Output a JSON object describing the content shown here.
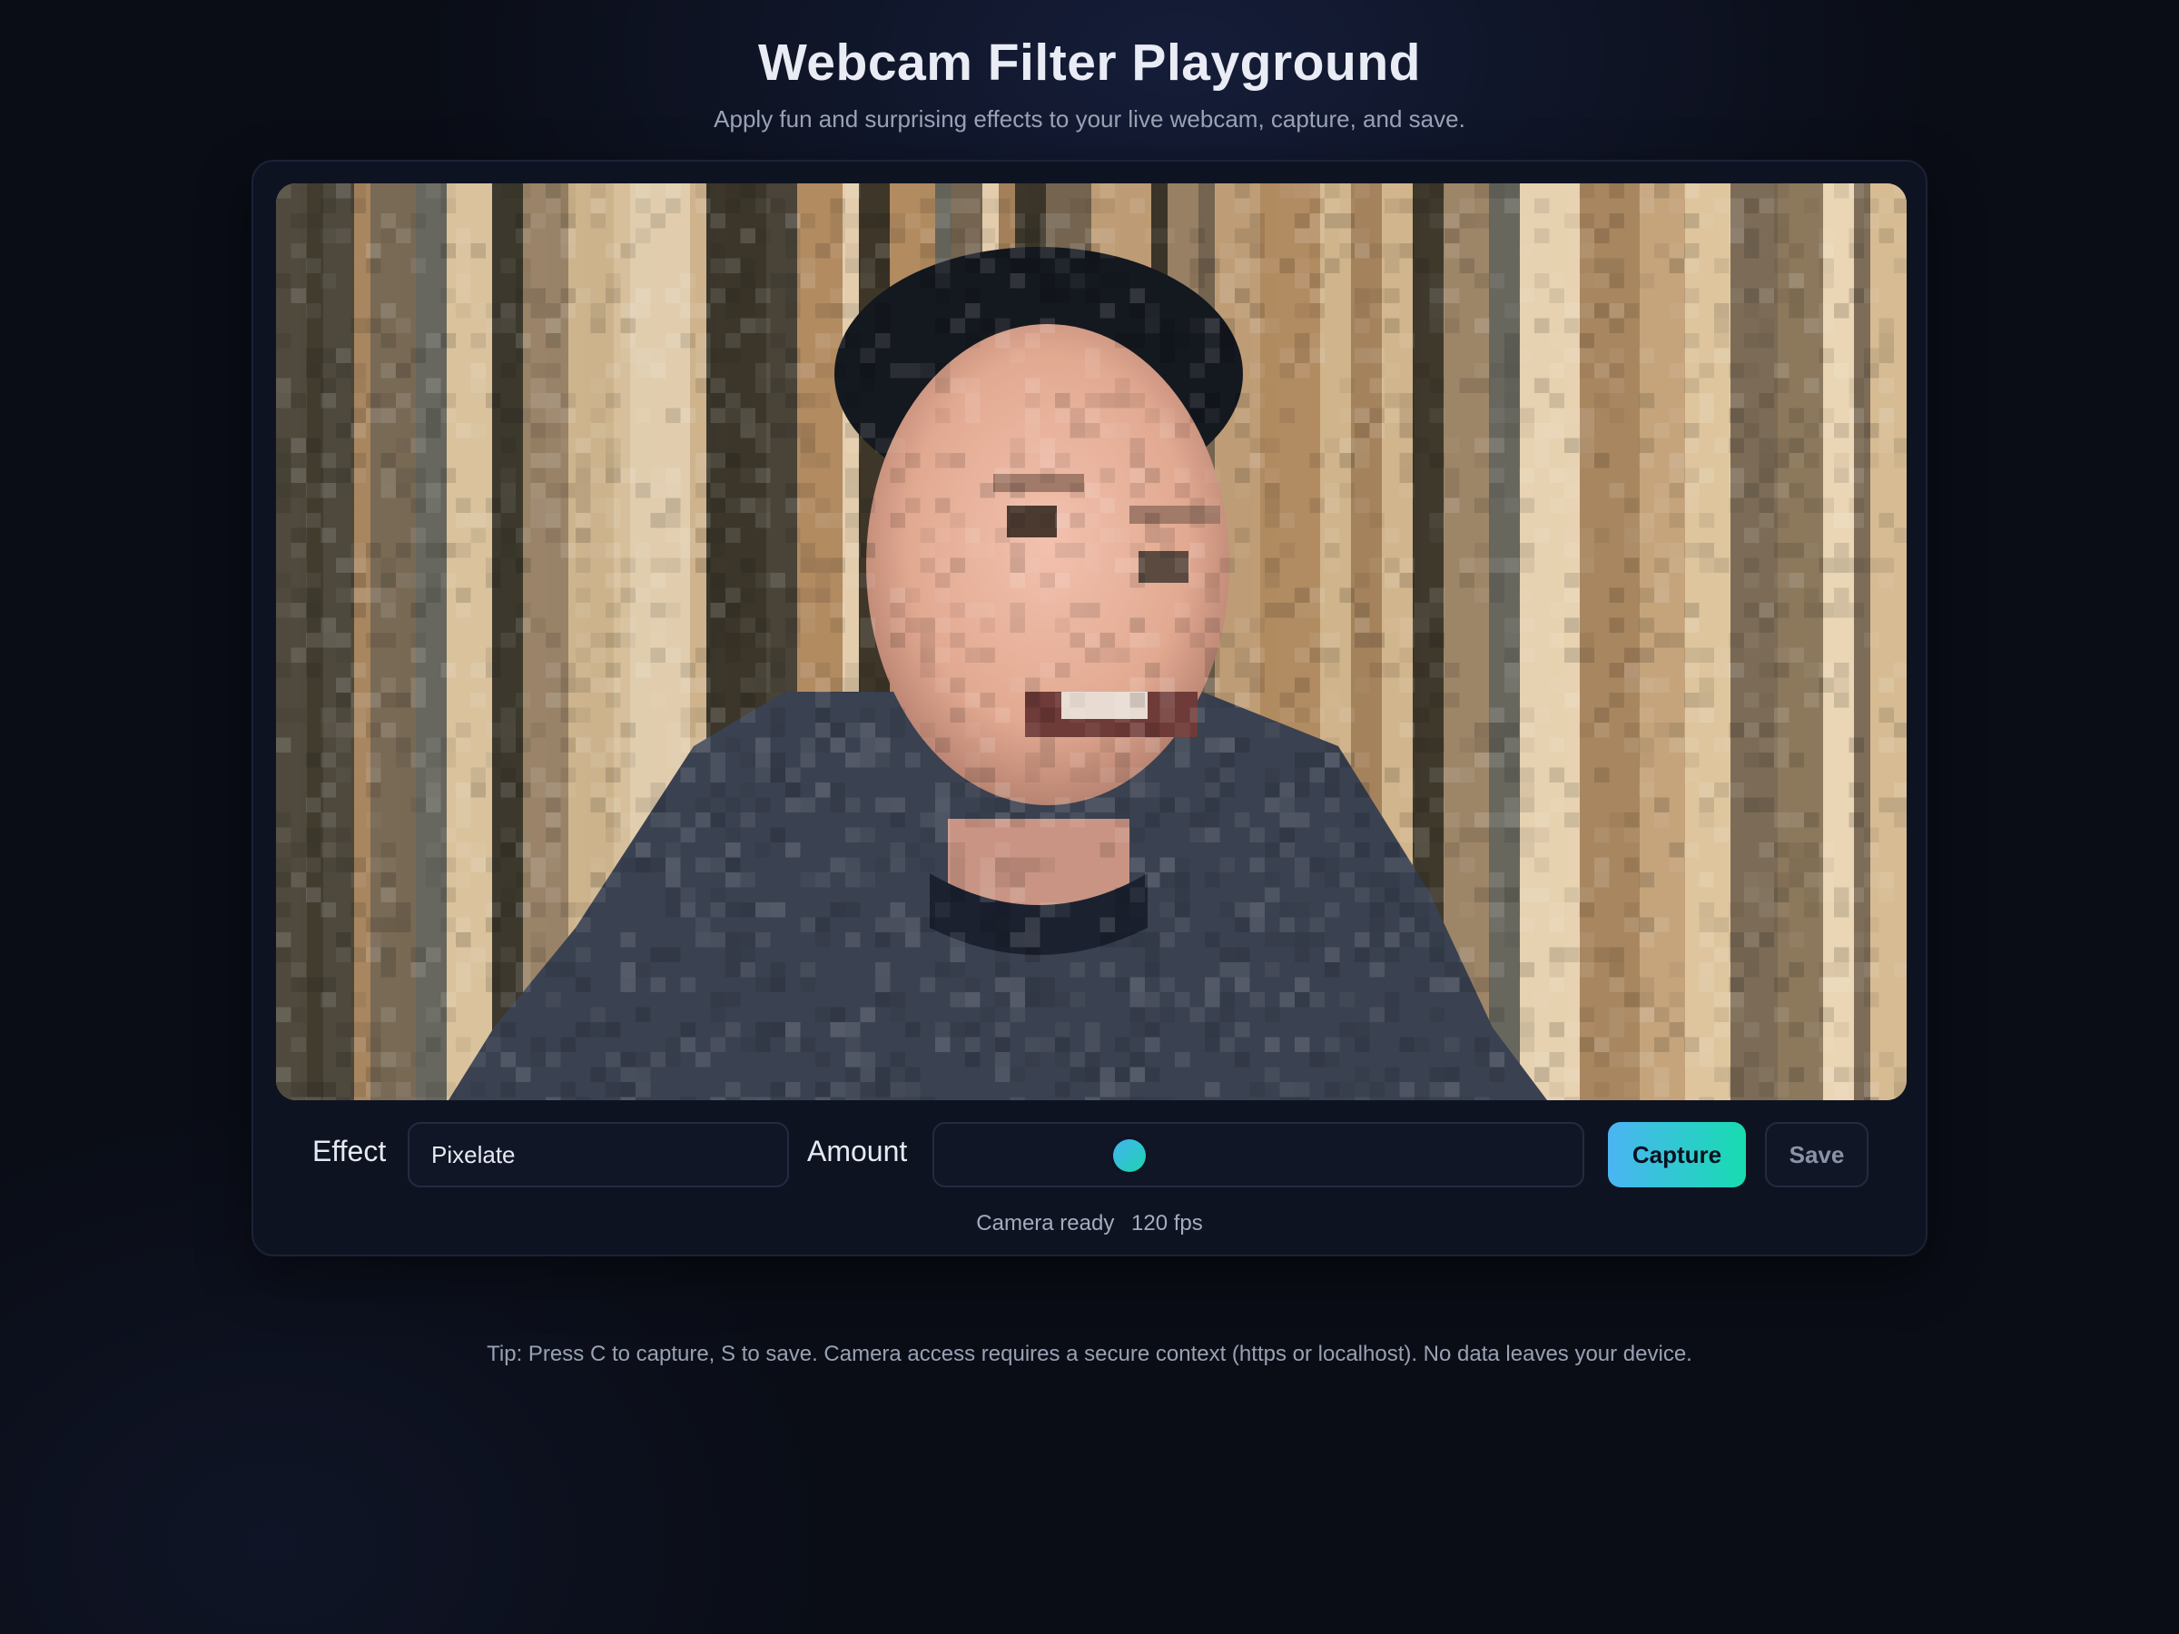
{
  "page": {
    "title": "Webcam Filter Playground",
    "subtitle": "Apply fun and surprising effects to your live webcam, capture, and save."
  },
  "controls": {
    "effect_label": "Effect",
    "effect_value": "Pixelate",
    "amount_label": "Amount",
    "amount_value": 0.29,
    "capture_label": "Capture",
    "save_label": "Save"
  },
  "status": {
    "camera": "Camera ready",
    "fps": "120 fps"
  },
  "footer": {
    "tip": "Tip: Press C to capture, S to save. Camera access requires a secure context (https or localhost). No data leaves your device."
  },
  "colors": {
    "accent_start": "#4bb4f3",
    "accent_end": "#17dcb0",
    "background": "#0a0d16",
    "card": "#0e1322"
  }
}
